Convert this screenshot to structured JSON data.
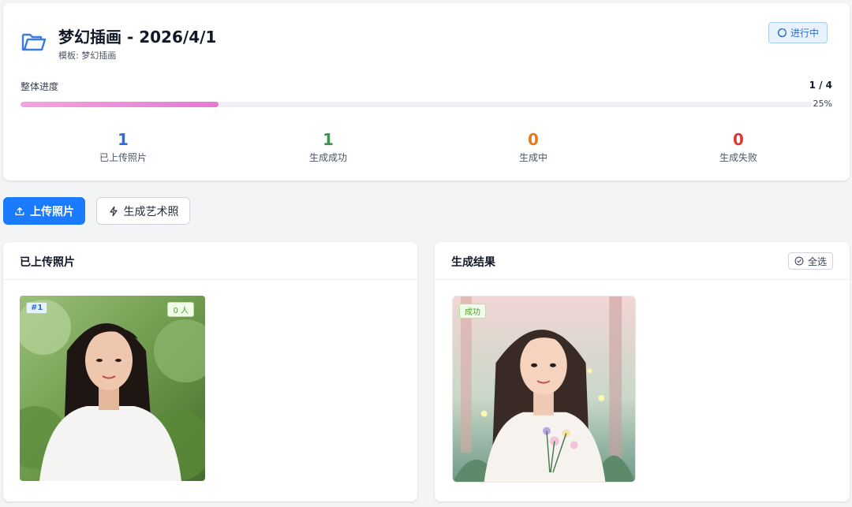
{
  "header": {
    "title": "梦幻插画 - 2026/4/1",
    "template": "模板: 梦幻插画",
    "status": "进行中",
    "icons": {
      "folder": "folder-open-icon",
      "status": "loading-icon"
    }
  },
  "progress": {
    "label": "整体进度",
    "count": "1 / 4",
    "percent_text": "25%",
    "fraction": 0.25,
    "colors": [
      "#f3a4e0",
      "#e57ad3"
    ]
  },
  "stats": [
    {
      "value": "1",
      "label": "已上传照片",
      "color": "#2d6fd6"
    },
    {
      "value": "1",
      "label": "生成成功",
      "color": "#2f9a4b"
    },
    {
      "value": "0",
      "label": "生成中",
      "color": "#e07b22"
    },
    {
      "value": "0",
      "label": "生成失败",
      "color": "#d93a3a"
    }
  ],
  "toolbar": {
    "upload_label": "上传照片",
    "generate_label": "生成艺术照",
    "upload_icon": "upload-icon",
    "generate_icon": "lightning-icon",
    "accent": "#1a7bff"
  },
  "uploaded_panel": {
    "title": "已上传照片",
    "items": [
      {
        "index": "#1",
        "people": "0 人"
      }
    ]
  },
  "results_panel": {
    "title": "生成结果",
    "select_all": "全选",
    "items": [
      {
        "status": "成功"
      }
    ]
  }
}
